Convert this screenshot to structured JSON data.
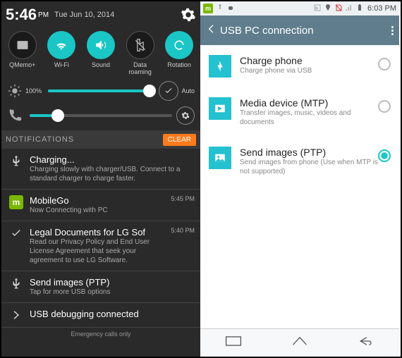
{
  "left": {
    "status": {
      "time": "5:46",
      "ampm": "PM",
      "date": "Tue Jun 10, 2014"
    },
    "toggles": [
      {
        "label": "QMemo+",
        "on": false
      },
      {
        "label": "Wi-Fi",
        "on": true
      },
      {
        "label": "Sound",
        "on": true
      },
      {
        "label": "Data roaming",
        "on": false
      },
      {
        "label": "Rotation",
        "on": true
      }
    ],
    "brightness": {
      "pct": "100%",
      "auto": "Auto",
      "value": 95
    },
    "volume": {
      "value": 20
    },
    "nh": {
      "title": "NOTIFICATIONS",
      "clear": "CLEAR"
    },
    "n": [
      {
        "title": "Charging...",
        "sub": "Charging slowly with charger/USB. Connect to a standard charger to charge faster.",
        "ts": ""
      },
      {
        "title": "MobileGo",
        "sub": "Now Connecting with PC",
        "ts": "5:45 PM"
      },
      {
        "title": "Legal Documents for LG Sof",
        "sub": "Read our Privacy Policy and End User License Agreement that seek your agreement to use LG Software.",
        "ts": "5:40 PM"
      },
      {
        "title": "Send images (PTP)",
        "sub": "Tap for more USB options",
        "ts": ""
      },
      {
        "title": "USB debugging connected",
        "sub": "",
        "ts": ""
      }
    ],
    "emg": "Emergency calls only"
  },
  "right": {
    "status": {
      "time": "6:03 PM"
    },
    "head": "USB PC connection",
    "items": [
      {
        "t": "Charge phone",
        "s": "Charge phone via USB",
        "sel": false
      },
      {
        "t": "Media device (MTP)",
        "s": "Transfer images, music, videos and documents",
        "sel": false
      },
      {
        "t": "Send images (PTP)",
        "s": "Send images from phone (Use when MTP is not supported)",
        "sel": true
      }
    ]
  }
}
